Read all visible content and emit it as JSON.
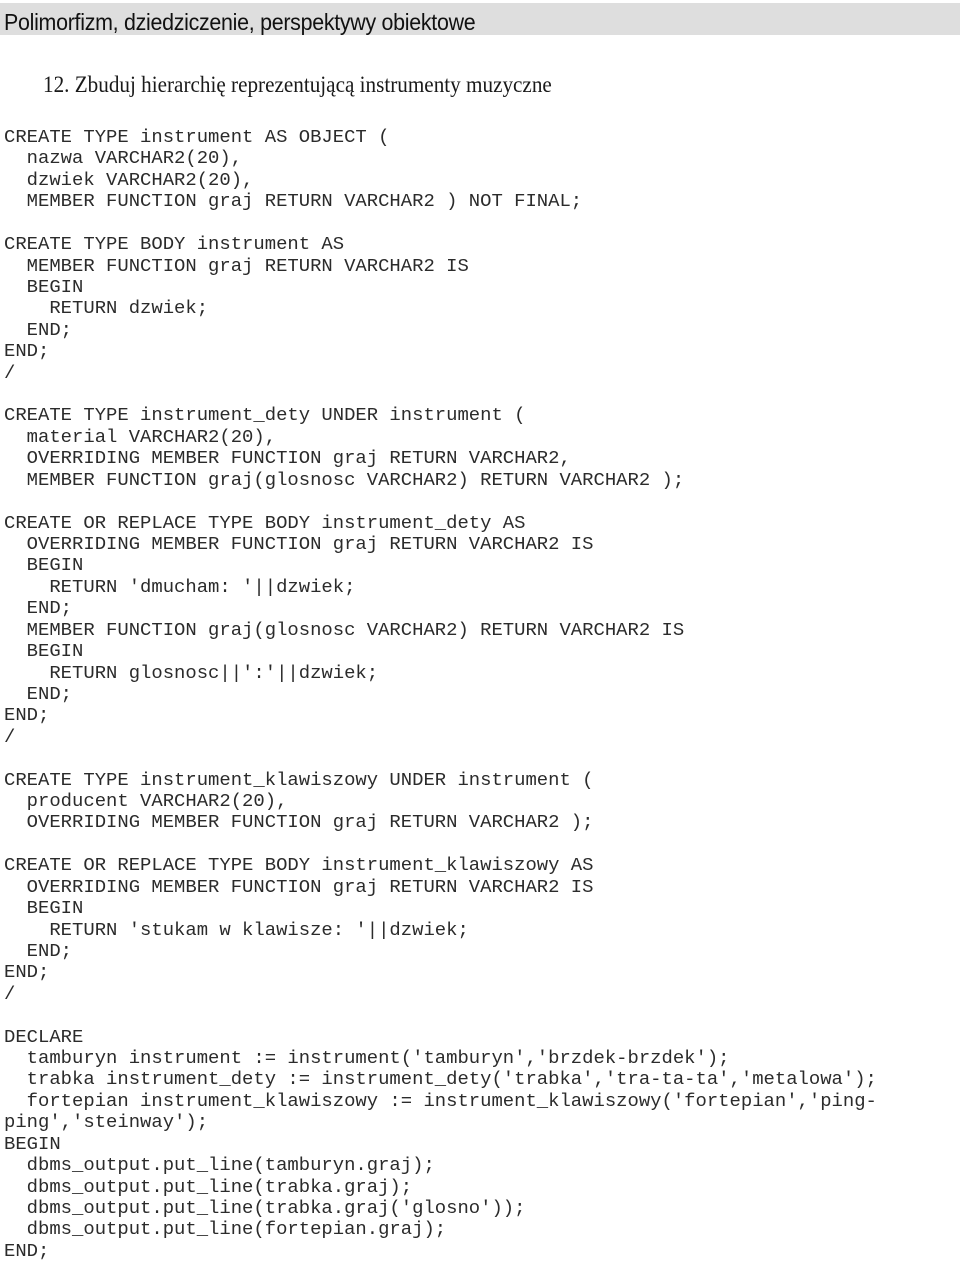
{
  "header": {
    "title": "Polimorfizm, dziedziczenie, perspektywy obiektowe"
  },
  "task": {
    "title": "12. Zbuduj hierarchię reprezentującą instrumenty muzyczne"
  },
  "code": {
    "lines": [
      "CREATE TYPE instrument AS OBJECT (",
      "  nazwa VARCHAR2(20),",
      "  dzwiek VARCHAR2(20),",
      "  MEMBER FUNCTION graj RETURN VARCHAR2 ) NOT FINAL;",
      "",
      "CREATE TYPE BODY instrument AS",
      "  MEMBER FUNCTION graj RETURN VARCHAR2 IS",
      "  BEGIN",
      "    RETURN dzwiek;",
      "  END;",
      "END;",
      "/",
      "",
      "CREATE TYPE instrument_dety UNDER instrument (",
      "  material VARCHAR2(20),",
      "  OVERRIDING MEMBER FUNCTION graj RETURN VARCHAR2,",
      "  MEMBER FUNCTION graj(glosnosc VARCHAR2) RETURN VARCHAR2 );",
      "",
      "CREATE OR REPLACE TYPE BODY instrument_dety AS",
      "  OVERRIDING MEMBER FUNCTION graj RETURN VARCHAR2 IS",
      "  BEGIN",
      "    RETURN 'dmucham: '||dzwiek;",
      "  END;",
      "  MEMBER FUNCTION graj(glosnosc VARCHAR2) RETURN VARCHAR2 IS",
      "  BEGIN",
      "    RETURN glosnosc||':'||dzwiek;",
      "  END;",
      "END;",
      "/",
      "",
      "CREATE TYPE instrument_klawiszowy UNDER instrument (",
      "  producent VARCHAR2(20),",
      "  OVERRIDING MEMBER FUNCTION graj RETURN VARCHAR2 );",
      "",
      "CREATE OR REPLACE TYPE BODY instrument_klawiszowy AS",
      "  OVERRIDING MEMBER FUNCTION graj RETURN VARCHAR2 IS",
      "  BEGIN",
      "    RETURN 'stukam w klawisze: '||dzwiek;",
      "  END;",
      "END;",
      "/",
      "",
      "DECLARE",
      "  tamburyn instrument := instrument('tamburyn','brzdek-brzdek');",
      "  trabka instrument_dety := instrument_dety('trabka','tra-ta-ta','metalowa');",
      "  fortepian instrument_klawiszowy := instrument_klawiszowy('fortepian','ping-",
      "ping','steinway');",
      "BEGIN",
      "  dbms_output.put_line(tamburyn.graj);",
      "  dbms_output.put_line(trabka.graj);",
      "  dbms_output.put_line(trabka.graj('glosno'));",
      "  dbms_output.put_line(fortepian.graj);",
      "END;"
    ]
  }
}
